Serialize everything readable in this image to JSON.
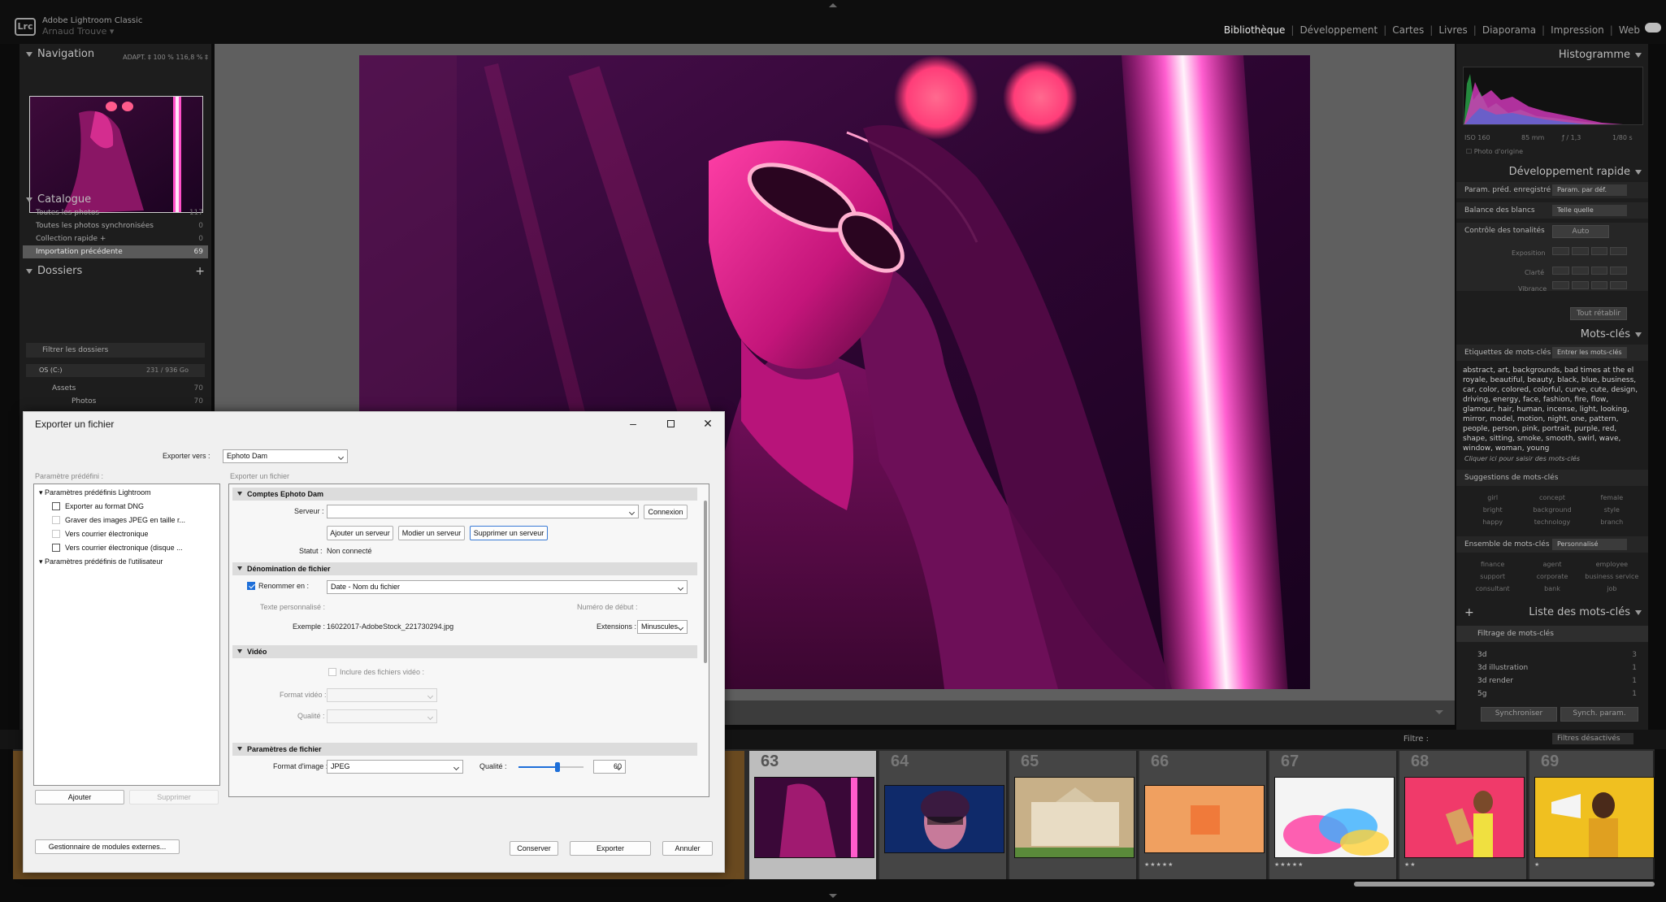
{
  "app": {
    "logo": "Lrc",
    "name": "Adobe Lightroom Classic",
    "user": "Arnaud Trouve"
  },
  "modules": [
    "Bibliothèque",
    "Développement",
    "Cartes",
    "Livres",
    "Diaporama",
    "Impression",
    "Web"
  ],
  "left_panel": {
    "navigation": {
      "title": "Navigation",
      "options": "ADAPT. ‡   100 %   116,8 % ‡"
    },
    "catalog": {
      "title": "Catalogue",
      "items": [
        {
          "label": "Toutes les photos",
          "count": "117"
        },
        {
          "label": "Toutes les photos synchronisées",
          "count": "0"
        },
        {
          "label": "Collection rapide +",
          "count": "0"
        },
        {
          "label": "Importation précédente",
          "count": "69"
        }
      ]
    },
    "folders": {
      "title": "Dossiers",
      "filter_placeholder": "Filtrer les dossiers",
      "drive": "OS (C:)",
      "drive_space": "231 / 936 Go",
      "items": [
        {
          "label": "Assets",
          "count": "70"
        },
        {
          "label": "Photos",
          "count": "70"
        }
      ]
    }
  },
  "right_panel": {
    "histogram": {
      "title": "Histogramme",
      "info": [
        "ISO 160",
        "85 mm",
        "ƒ / 1,3",
        "1/80 s"
      ],
      "original_photo": "Photo d'origine"
    },
    "quick_develop": {
      "title": "Développement rapide",
      "preset_label": "Param. préd. enregistré",
      "preset_value": "Param. par déf.",
      "wb_label": "Balance des blancs",
      "wb_value": "Telle quelle",
      "tone_label": "Contrôle des tonalités",
      "auto": "Auto",
      "exposure": "Exposition",
      "clarity": "Clarté",
      "vibrance": "Vibrance",
      "reset": "Tout rétablir"
    },
    "keywording": {
      "title": "Mots-clés",
      "tags_label": "Etiquettes de mots-clés",
      "tags_mode": "Entrer les mots-clés",
      "keywords": "abstract, art, backgrounds, bad times at the el royale, beautiful, beauty, black, blue, business, car, color, colored, colorful, curve, cute, design, driving, energy, face, fashion, fire, flow, glamour, hair, human, incense, light, looking, mirror, model, motion, night, one, pattern, people, person, pink, portrait, purple, red, shape, sitting, smoke, smooth, swirl, wave, window, woman, young",
      "click_hint": "Cliquer ici pour saisir des mots-clés",
      "suggestions_label": "Suggestions de mots-clés",
      "suggestions": [
        "girl",
        "concept",
        "female",
        "bright",
        "background",
        "style",
        "happy",
        "technology",
        "branch"
      ],
      "set_label": "Ensemble de mots-clés",
      "set_value": "Personnalisé",
      "set_items": [
        "finance",
        "agent",
        "employee",
        "support",
        "corporate",
        "business service",
        "consultant",
        "bank",
        "job"
      ]
    },
    "keyword_list": {
      "title": "Liste des mots-clés",
      "filter_placeholder": "Filtrage de mots-clés",
      "items": [
        {
          "label": "3d",
          "count": "3"
        },
        {
          "label": "3d illustration",
          "count": "1"
        },
        {
          "label": "3d render",
          "count": "1"
        },
        {
          "label": "5g",
          "count": "1"
        }
      ]
    },
    "sync_button": "Synchroniser",
    "sync_settings_button": "Synch. param."
  },
  "filmstrip": {
    "filter_label": "Filtre :",
    "filter_value": "Filtres désactivés",
    "cells": [
      {
        "num": "63",
        "stars": ""
      },
      {
        "num": "64",
        "stars": ""
      },
      {
        "num": "65",
        "stars": ""
      },
      {
        "num": "66",
        "stars": "★★★★★"
      },
      {
        "num": "67",
        "stars": "★★★★★"
      },
      {
        "num": "68",
        "stars": "★★"
      },
      {
        "num": "69",
        "stars": "★"
      }
    ]
  },
  "dialog": {
    "title": "Exporter un fichier",
    "export_to_label": "Exporter vers :",
    "export_to_value": "Ephoto Dam",
    "preset_header": "Paramètre prédéfini :",
    "export_header": "Exporter un fichier",
    "presets": {
      "lightroom_group": "Paramètres prédéfinis Lightroom",
      "items": [
        "Exporter au format DNG",
        "Graver des images JPEG en taille r...",
        "Vers courrier électronique",
        "Vers courrier électronique (disque ..."
      ],
      "user_group": "Paramètres prédéfinis de l'utilisateur"
    },
    "add_button": "Ajouter",
    "remove_button": "Supprimer",
    "plugins_button": "Gestionnaire de modules externes...",
    "keep_button": "Conserver",
    "export_button": "Exporter",
    "cancel_button": "Annuler",
    "accounts": {
      "title": "Comptes Ephoto Dam",
      "server_label": "Serveur :",
      "server_value": "",
      "connect_button": "Connexion",
      "add_server": "Ajouter un serveur",
      "edit_server": "Modier un serveur",
      "delete_server": "Supprimer un serveur",
      "status_label": "Statut :",
      "status_value": "Non connecté"
    },
    "naming": {
      "title": "Dénomination de fichier",
      "rename_label": "Renommer en :",
      "rename_value": "Date - Nom du fichier",
      "custom_text_label": "Texte personnalisé :",
      "start_number_label": "Numéro de début :",
      "example_label": "Exemple :",
      "example_value": "16022017-AdobeStock_221730294.jpg",
      "extensions_label": "Extensions :",
      "extensions_value": "Minuscules"
    },
    "video": {
      "title": "Vidéo",
      "include_label": "Inclure des fichiers vidéo :",
      "format_label": "Format vidéo :",
      "quality_label": "Qualité :"
    },
    "file_settings": {
      "title": "Paramètres de fichier",
      "format_label": "Format d'image :",
      "format_value": "JPEG",
      "quality_label": "Qualité :",
      "quality_value": "60",
      "quality_level": 0.6
    }
  }
}
